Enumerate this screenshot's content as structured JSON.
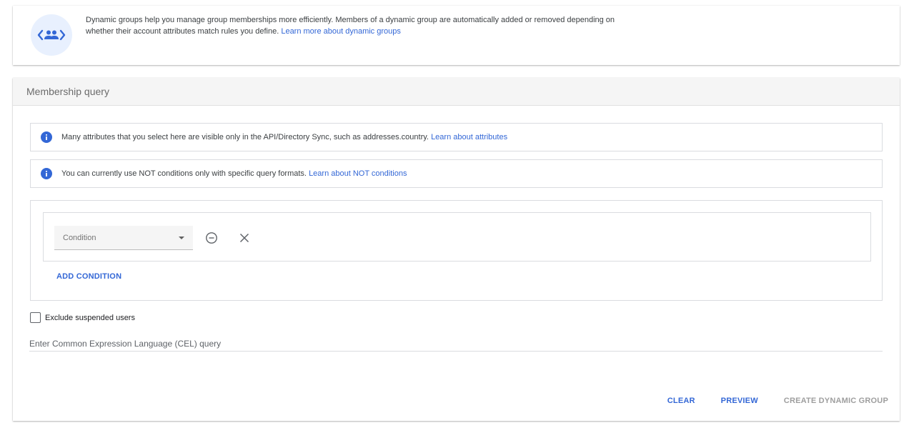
{
  "intro": {
    "text": "Dynamic groups help you manage group memberships more efficiently. Members of a dynamic group are automatically added or removed depending on whether their account attributes match rules you define.",
    "link": "Learn more about dynamic groups",
    "icon": "dynamic-group-icon"
  },
  "membership_query": {
    "title": "Membership query",
    "notices": [
      {
        "text": "Many attributes that you select here are visible only in the API/Directory Sync, such as addresses.country.",
        "link": "Learn about attributes"
      },
      {
        "text": "You can currently use NOT conditions only with specific query formats.",
        "link": "Learn about NOT conditions"
      }
    ],
    "condition": {
      "placeholder": "Condition"
    },
    "add_condition_label": "ADD CONDITION",
    "exclude_suspended_label": "Exclude suspended users",
    "exclude_suspended_checked": false,
    "cel_placeholder": "Enter Common Expression Language (CEL) query",
    "actions": {
      "clear": "CLEAR",
      "preview": "PREVIEW",
      "create": "CREATE DYNAMIC GROUP"
    }
  },
  "colors": {
    "accent": "#3367d6",
    "info_icon": "#3367d6",
    "icon_bg": "#e8f0fe"
  }
}
